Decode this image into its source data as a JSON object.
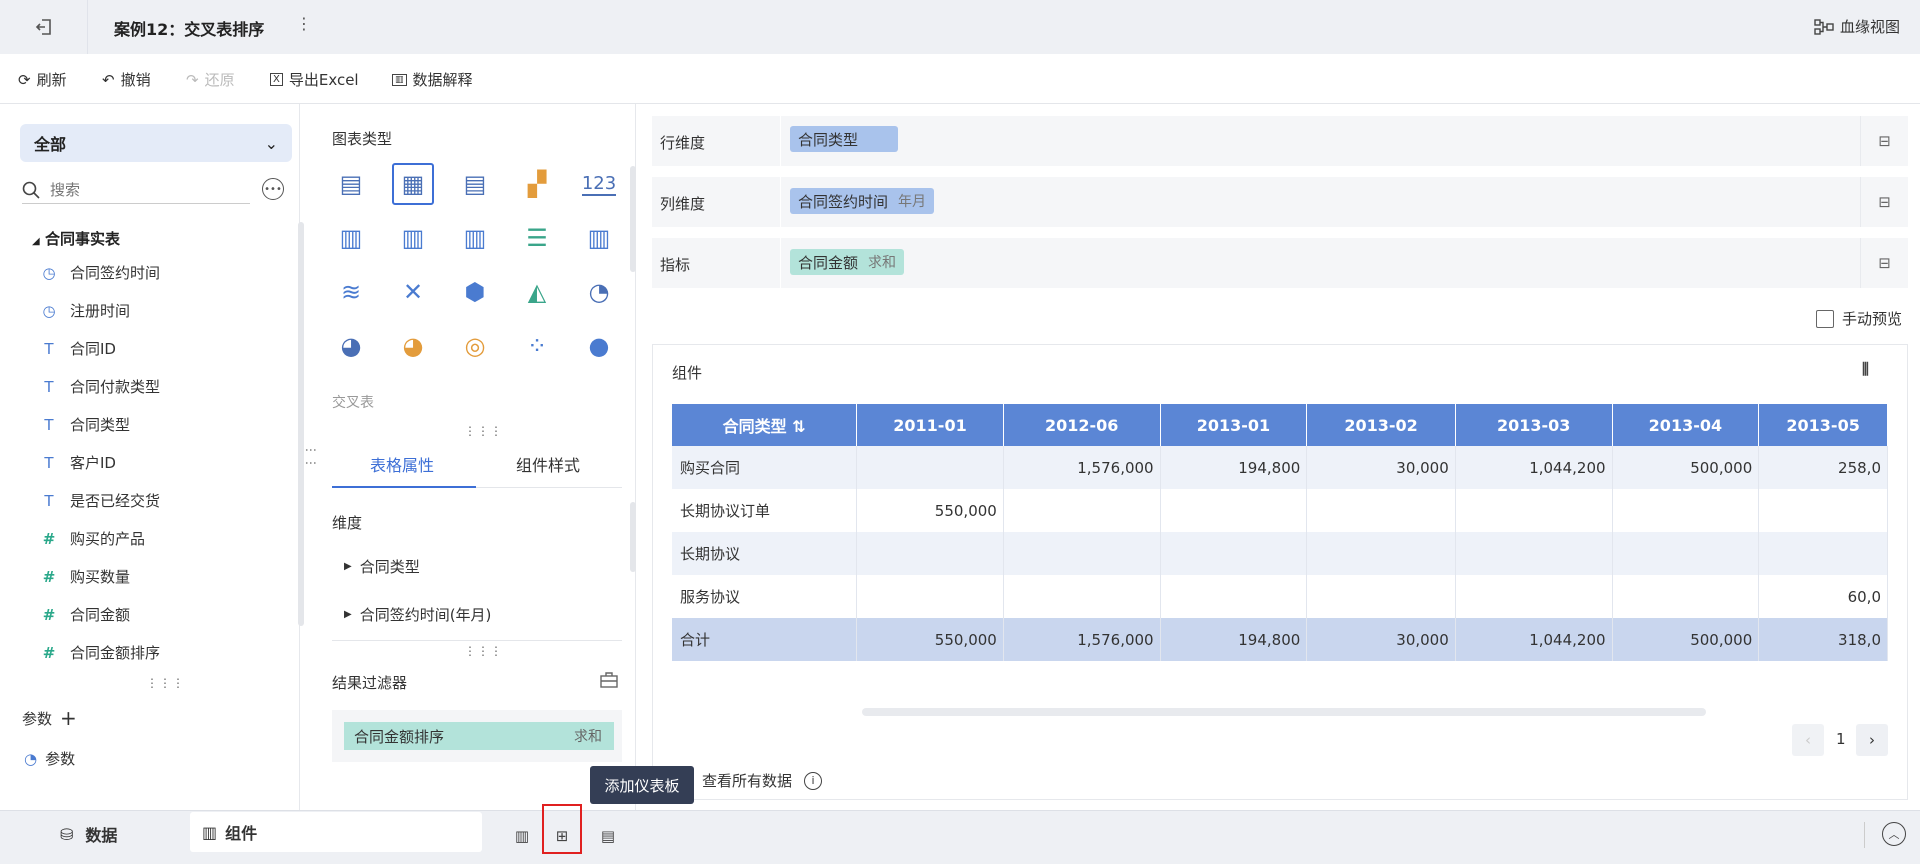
{
  "header": {
    "title": "案例12：交叉表排序",
    "lineage_label": "血缘视图"
  },
  "toolbar": {
    "refresh": "刷新",
    "undo": "撤销",
    "redo": "还原",
    "export": "导出Excel",
    "explain": "数据解释"
  },
  "left": {
    "scope": "全部",
    "search_placeholder": "搜索",
    "tree_root": "合同事实表",
    "fields": [
      {
        "label": "合同签约时间",
        "type": "time"
      },
      {
        "label": "注册时间",
        "type": "time"
      },
      {
        "label": "合同ID",
        "type": "text"
      },
      {
        "label": "合同付款类型",
        "type": "text"
      },
      {
        "label": "合同类型",
        "type": "text"
      },
      {
        "label": "客户ID",
        "type": "text"
      },
      {
        "label": "是否已经交货",
        "type": "text"
      },
      {
        "label": "购买的产品",
        "type": "num"
      },
      {
        "label": "购买数量",
        "type": "num"
      },
      {
        "label": "合同金额",
        "type": "num"
      },
      {
        "label": "合同金额排序",
        "type": "num"
      }
    ],
    "param_section": "参数",
    "param_item": "参数"
  },
  "middle": {
    "chart_type_title": "图表类型",
    "crosstab_label": "交叉表",
    "tab_table": "表格属性",
    "tab_style": "组件样式",
    "dimension_title": "维度",
    "dimensions": [
      "合同类型",
      "合同签约时间(年月)"
    ],
    "filter_title": "结果过滤器",
    "filter_field": "合同金额排序",
    "filter_agg": "求和",
    "number_icon_text": "123"
  },
  "shelves": {
    "row_label": "行维度",
    "row_field": "合同类型",
    "col_label": "列维度",
    "col_field": "合同签约时间",
    "col_agg": "年月",
    "metric_label": "指标",
    "metric_field": "合同金额",
    "metric_agg": "求和"
  },
  "manual_preview": "手动预览",
  "component": {
    "title": "组件",
    "corner_header": "合同类型",
    "columns": [
      "2011-01",
      "2012-06",
      "2013-01",
      "2013-02",
      "2013-03",
      "2013-04",
      "2013-05"
    ],
    "rows": [
      {
        "label": "购买合同",
        "cells": [
          "",
          "1,576,000",
          "194,800",
          "30,000",
          "1,044,200",
          "500,000",
          "258,0"
        ]
      },
      {
        "label": "长期协议订单",
        "cells": [
          "550,000",
          "",
          "",
          "",
          "",
          "",
          ""
        ]
      },
      {
        "label": "长期协议",
        "cells": [
          "",
          "",
          "",
          "",
          "",
          "",
          ""
        ]
      },
      {
        "label": "服务协议",
        "cells": [
          "",
          "",
          "",
          "",
          "",
          "",
          "60,0"
        ]
      }
    ],
    "total": {
      "label": "合计",
      "cells": [
        "550,000",
        "1,576,000",
        "194,800",
        "30,000",
        "1,044,200",
        "500,000",
        "318,0"
      ]
    },
    "page": "1",
    "view_all": "查看所有数据"
  },
  "tooltip": "添加仪表板",
  "bottom": {
    "data_tab": "数据",
    "component_tab": "组件"
  }
}
